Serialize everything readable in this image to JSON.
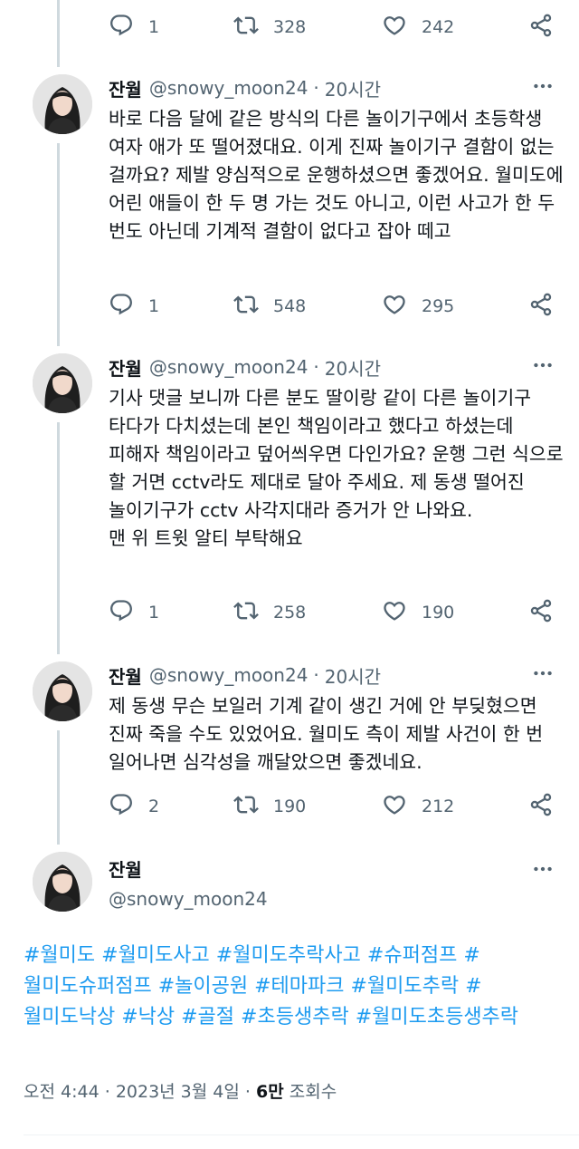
{
  "user": {
    "name": "잔월",
    "handle": "@snowy_moon24",
    "time": "20시간"
  },
  "top_actions": {
    "replies": "1",
    "retweets": "328",
    "likes": "242"
  },
  "tweets": [
    {
      "text": "바로 다음 달에 같은 방식의 다른 놀이기구에서 초등학생 여자 애가 또 떨어졌대요. 이게 진짜 놀이기구 결함이 없는 걸까요? 제발 양심적으로 운행하셨으면 좋겠어요. 월미도에 어린 애들이 한 두 명 가는 것도 아니고, 이런 사고가 한 두 번도 아닌데 기계적 결함이 없다고 잡아 떼고",
      "replies": "1",
      "retweets": "548",
      "likes": "295"
    },
    {
      "text": "기사 댓글 보니까 다른 분도 딸이랑 같이 다른 놀이기구 타다가 다치셨는데 본인 책임이라고 했다고 하셨는데 피해자 책임이라고 덮어씌우면 다인가요? 운행 그런 식으로 할 거면 cctv라도 제대로 달아 주세요. 제 동생 떨어진 놀이기구가 cctv 사각지대라 증거가 안 나와요.\n맨 위 트윗 알티 부탁해요",
      "replies": "1",
      "retweets": "258",
      "likes": "190"
    },
    {
      "text": "제 동생 무슨 보일러 기계 같이 생긴 거에 안 부딪혔으면 진짜 죽을 수도 있었어요. 월미도 측이 제발 사건이 한 번 일어나면 심각성을 깨달았으면 좋겠네요.",
      "replies": "2",
      "retweets": "190",
      "likes": "212"
    }
  ],
  "main": {
    "hashtags": [
      "#월미도",
      "#월미도사고",
      "#월미도추락사고",
      "#슈퍼점프",
      "#월미도슈퍼점프",
      "#놀이공원",
      "#테마파크",
      "#월미도추락",
      "#월미도낙상",
      "#낙상",
      "#골절",
      "#초등생추락",
      "#월미도초등생추락"
    ],
    "time": "오전 4:44",
    "date": "2023년 3월 4일",
    "views_count": "6만",
    "views_label": "조회수"
  },
  "icons": {
    "reply": "reply-icon",
    "retweet": "retweet-icon",
    "like": "heart-icon",
    "share": "share-icon",
    "more": "more-icon"
  },
  "colors": {
    "hashtag": "#1d9bf0",
    "muted": "#536471",
    "text": "#0f1419",
    "thread_line": "#cfd9de"
  }
}
